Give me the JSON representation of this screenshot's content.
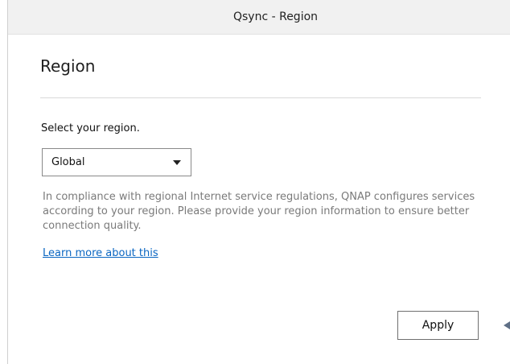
{
  "window": {
    "title": "Qsync - Region"
  },
  "page": {
    "heading": "Region",
    "select_label": "Select your region.",
    "region_dropdown": {
      "selected": "Global"
    },
    "description": "In compliance with regional Internet service regulations, QNAP configures services according to your region. Please provide your region information to ensure better connection quality.",
    "learn_more_link": "Learn more about this",
    "apply_label": "Apply"
  },
  "icons": {
    "dropdown": "chevron-down-icon",
    "edge": "arrow-left-icon"
  },
  "colors": {
    "link": "#0a66c2",
    "muted_text": "#7a7a7a",
    "titlebar_bg": "#f1f1f1"
  }
}
